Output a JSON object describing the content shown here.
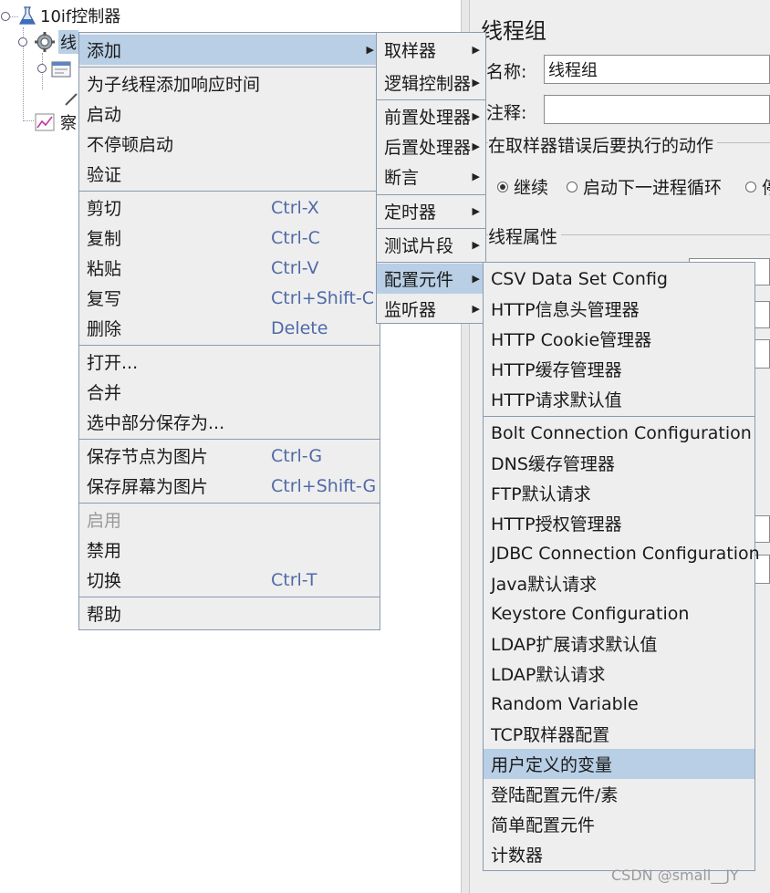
{
  "tree": {
    "root_label": "10if控制器",
    "thread_group_label": "线",
    "listener_label": "察"
  },
  "right_panel": {
    "title": "线程组",
    "name_label": "名称:",
    "name_value": "线程组",
    "comment_label": "注释:",
    "error_action_legend": "在取样器错误后要执行的动作",
    "radio_continue": "继续",
    "radio_next_loop": "启动下一进程循环",
    "radio_more": "停",
    "thread_props_legend": "线程属性"
  },
  "context_menu": {
    "add": "添加",
    "add_response_time": "为子线程添加响应时间",
    "start": "启动",
    "start_no_pause": "不停顿启动",
    "validate": "验证",
    "cut": "剪切",
    "cut_sc": "Ctrl-X",
    "copy": "复制",
    "copy_sc": "Ctrl-C",
    "paste": "粘贴",
    "paste_sc": "Ctrl-V",
    "duplicate": "复写",
    "duplicate_sc": "Ctrl+Shift-C",
    "delete": "删除",
    "delete_sc": "Delete",
    "open": "打开...",
    "merge": "合并",
    "save_selection": "选中部分保存为...",
    "save_node_image": "保存节点为图片",
    "save_node_image_sc": "Ctrl-G",
    "save_screen_image": "保存屏幕为图片",
    "save_screen_image_sc": "Ctrl+Shift-G",
    "enable": "启用",
    "disable": "禁用",
    "toggle": "切换",
    "toggle_sc": "Ctrl-T",
    "help": "帮助"
  },
  "add_submenu": {
    "sampler": "取样器",
    "logic_controller": "逻辑控制器",
    "pre_processor": "前置处理器",
    "post_processor": "后置处理器",
    "assertion": "断言",
    "timer": "定时器",
    "test_fragment": "测试片段",
    "config_element": "配置元件",
    "listener": "监听器"
  },
  "config_submenu": {
    "items_top": [
      "CSV Data Set Config",
      "HTTP信息头管理器",
      "HTTP Cookie管理器",
      "HTTP缓存管理器",
      "HTTP请求默认值"
    ],
    "items_bottom": [
      "Bolt Connection Configuration",
      "DNS缓存管理器",
      "FTP默认请求",
      "HTTP授权管理器",
      "JDBC Connection Configuration",
      "Java默认请求",
      "Keystore Configuration",
      "LDAP扩展请求默认值",
      "LDAP默认请求",
      "Random Variable",
      "TCP取样器配置",
      "用户定义的变量",
      "登陆配置元件/素",
      "简单配置元件",
      "计数器"
    ],
    "highlighted": "用户定义的变量"
  },
  "watermark": "CSDN @small__JY",
  "colors": {
    "highlight": "#b8cfe5",
    "shortcut": "#4f6aa8",
    "menu_bg": "#eeeeee"
  }
}
